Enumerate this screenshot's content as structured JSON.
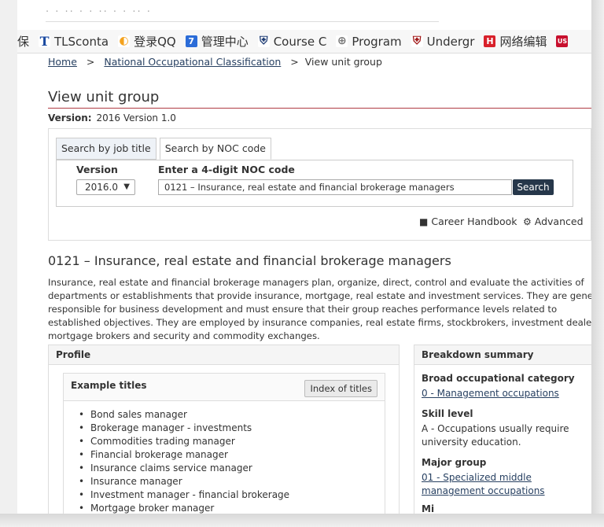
{
  "browser": {
    "address_partial": "· · ·· · · ·· · · ·· ·",
    "bookmarks": [
      {
        "label": "保",
        "icon": "",
        "color": "#ffffff"
      },
      {
        "label": "TLSconta",
        "icon": "T",
        "color": "#1a4aa0"
      },
      {
        "label": "登录QQ",
        "icon": "◐",
        "color": "#f4a21d"
      },
      {
        "label": "管理中心",
        "icon": "7",
        "color": "#2b6cd8"
      },
      {
        "label": "Course C",
        "icon": "⛨",
        "color": "#1e3c74"
      },
      {
        "label": "Program",
        "icon": "⊕",
        "color": "#777777"
      },
      {
        "label": "Undergr",
        "icon": "⛨",
        "color": "#a01818"
      },
      {
        "label": "网络编辑",
        "icon": "H",
        "color": "#d8202a"
      },
      {
        "label": "",
        "icon": "US",
        "color": "#c8102e"
      }
    ]
  },
  "breadcrumb": {
    "home": "Home",
    "noc": "National Occupational Classification",
    "current": "View unit group",
    "sep": ">"
  },
  "page": {
    "title": "View unit group",
    "version_label": "Version:",
    "version_value": "2016 Version 1.0"
  },
  "search": {
    "tab_job_title": "Search by job title",
    "tab_noc_code": "Search by NOC code",
    "version_label": "Version",
    "version_selected": "2016.0",
    "noc_label": "Enter a 4-digit NOC code",
    "noc_value": "0121 – Insurance, real estate and financial brokerage managers",
    "search_button": "Search",
    "career_handbook": "Career Handbook",
    "advanced": "Advanced"
  },
  "unit": {
    "title": "0121 – Insurance, real estate and financial brokerage managers",
    "description_lines": [
      "Insurance, real estate and financial brokerage managers plan, organize, direct, control and evaluate the activities of",
      "departments or establishments that provide insurance, mortgage, real estate and investment services. They are generally",
      "responsible for business development and must ensure that their group reaches performance levels related to",
      "established objectives. They are employed by insurance companies, real estate firms, stockbrokers, investment dealers,",
      "mortgage brokers and security and commodity exchanges."
    ]
  },
  "profile": {
    "heading": "Profile",
    "example_titles_heading": "Example titles",
    "index_button": "Index of titles",
    "titles": [
      "Bond sales manager",
      "Brokerage manager - investments",
      "Commodities trading manager",
      "Financial brokerage manager",
      "Insurance claims service manager",
      "Insurance manager",
      "Investment manager - financial brokerage",
      "Mortgage broker manager"
    ]
  },
  "breakdown": {
    "heading": "Breakdown summary",
    "broad_heading": "Broad occupational category",
    "broad_value": "0 - Management occupations",
    "skill_heading": "Skill level",
    "skill_line1": "A - Occupations usually require",
    "skill_line2": "university education.",
    "major_heading": "Major group",
    "major_line1": "01 - Specialized middle",
    "major_line2": "management occupations",
    "minor_heading": "Mi"
  }
}
